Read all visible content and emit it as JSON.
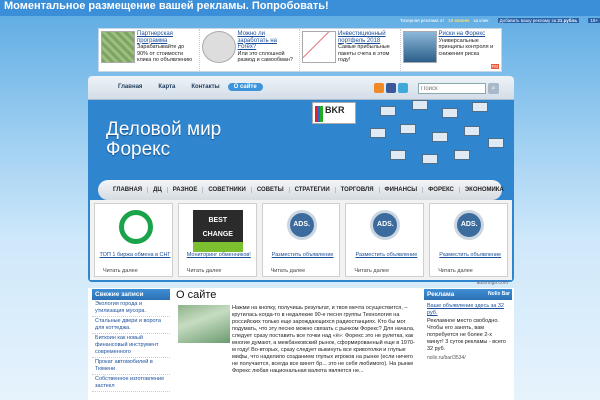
{
  "top_ad": {
    "text": "Моментальное размещение вашей рекламы. Попробовать!"
  },
  "ad_bar": {
    "prefix": "Тизерная реклама от",
    "count": "10 копеек",
    "suffix": "за клик",
    "badge": "18+",
    "add_label": "Добавить вашу рекламу за",
    "price": "21 рубль"
  },
  "teasers": [
    {
      "title": "Партнерская программа",
      "text": "Зарабатывайте до 90% от стоимости клика по объявлению"
    },
    {
      "title": "Можно ли заработать на Forex?",
      "text": "Или это сплошной развод и самообман?"
    },
    {
      "title": "Инвестиционный портфель 2018",
      "text": "Самые прибыльные пакеты счета в этом году!"
    },
    {
      "title": "Риски на Форекс",
      "text": "Универсальные принципы контроля и снижения риска"
    }
  ],
  "teaser_ad_mark": "FM",
  "nav_top": [
    "Главная",
    "Карта",
    "Контакты",
    "О сайте"
  ],
  "search": {
    "placeholder": "Поиск"
  },
  "site_title_line1": "Деловой мир",
  "site_title_line2": "Форекс",
  "bkr_label": "BKR",
  "nav_main": [
    "ГЛАВНАЯ",
    "ДЦ",
    "РАЗНОЕ",
    "СОВЕТНИКИ",
    "СОВЕТЫ",
    "СТРАТЕГИИ",
    "ТОРГОВЛЯ",
    "ФИНАНСЫ",
    "ФОРЕКС",
    "ЭКОНОМИКА"
  ],
  "banners": [
    {
      "caption": "ТОП 1 биржа обмена в СНГ",
      "more": "Читать далее"
    },
    {
      "logo": "BEST CHANGE",
      "caption": "Мониторинг обменников!",
      "more": "Читать далее"
    },
    {
      "logo": "ADS.",
      "caption": "Разместить объявление",
      "more": "Читать далее"
    },
    {
      "logo": "ADS.",
      "caption": "Разместить объявление",
      "more": "Читать далее"
    },
    {
      "logo": "ADS.",
      "caption": "Разместить объявление",
      "more": "Читать далее"
    }
  ],
  "banner_source": "adsmngo.com",
  "sidebar_left": {
    "title": "Свежие записи",
    "items": [
      "Экология города и утилизация мусора.",
      "Стальные двери и ворота для коттеджа.",
      "Биткоин как новый финансовый инструмент современного",
      "Прокат автомобилей в Тюмени",
      "Собственное изготовление застекл"
    ]
  },
  "article": {
    "title": "О сайте",
    "body": "Нажми на кнопку, получишь результат, и твоя мечта осуществится, – крутилась когда-то в недалекие 90-е песня группы Технология на российских только еще зарождающихся радиостанциях. Кто бы мог подумать, что эту песню можно связать с рынком Форекс? Для начала, следует сразу поставить все точки над «ё»: Форекс это не рулетка, как многие думают, а межбанковский рынок, сформированный еще в 1970-м году! Во-вторых, сразу следует выкинуть все кривотолки и глупые мифы, что наделило созданием глупых игроков на рынке (если ничего не получается, всегда все винят бр... это не себя любимого). На рынке Форекс любая национальная валюта является не..."
  },
  "sidebar_right": {
    "title": "Реклама",
    "badge": "Nolix Bar",
    "link_title": "Ваше объявление здесь за 32 руб.",
    "text": "Рекламное место свободно. Чтобы его занять, вам потребуется не более 2-х минут! 3 суток рекламы - всего 32 руб.",
    "link": "nolix.ru/bar/3534/"
  }
}
